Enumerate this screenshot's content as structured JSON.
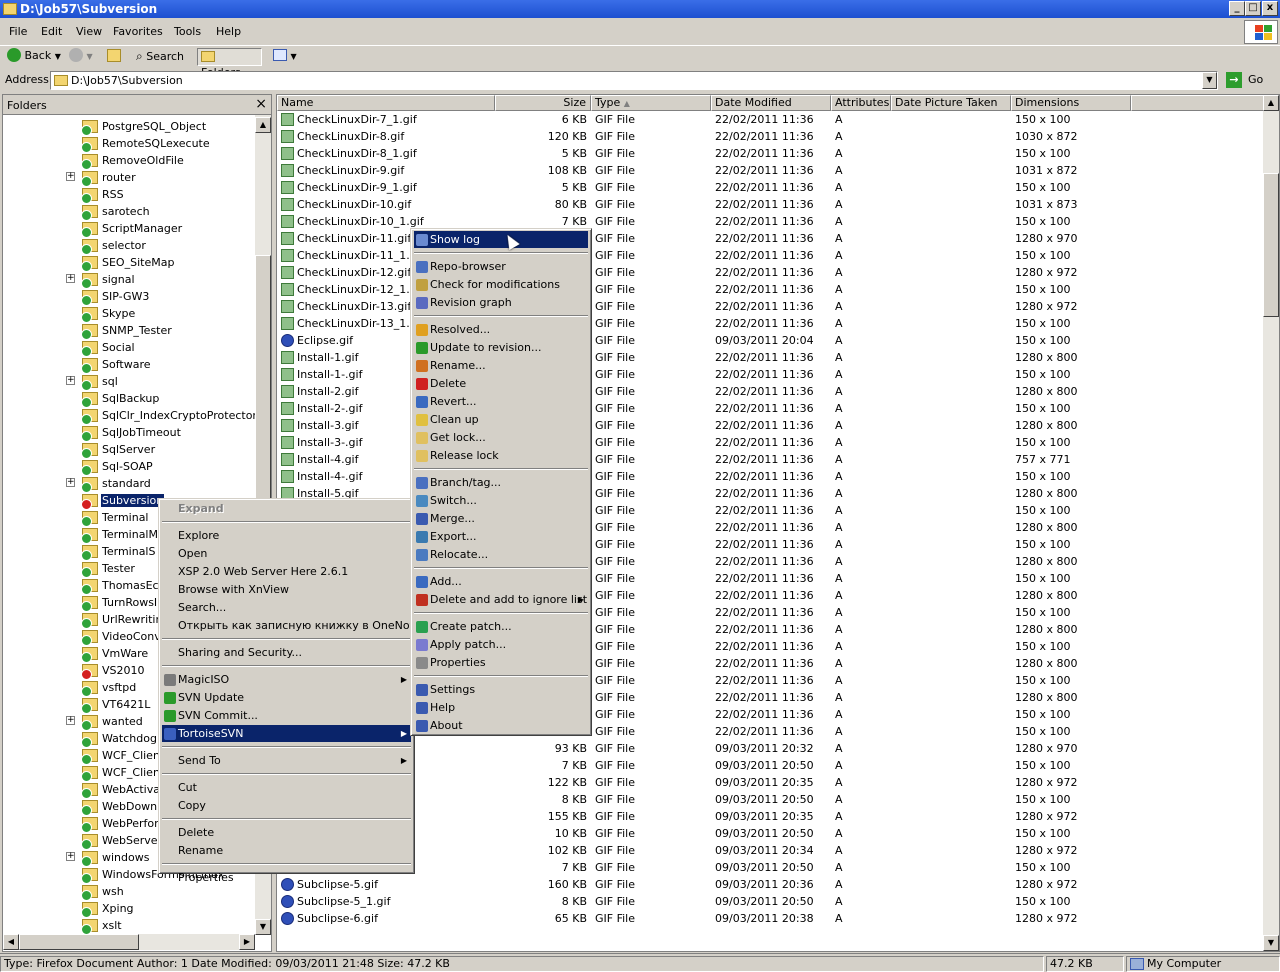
{
  "window": {
    "title": "D:\\Job57\\Subversion",
    "buttons": {
      "min": "_",
      "max": "□",
      "close": "x"
    }
  },
  "menubar": [
    "File",
    "Edit",
    "View",
    "Favorites",
    "Tools",
    "Help"
  ],
  "toolbar": {
    "back": "Back",
    "search": "Search",
    "folders": "Folders"
  },
  "address": {
    "label": "Address",
    "value": "D:\\Job57\\Subversion",
    "go": "Go"
  },
  "folders_pane": {
    "title": "Folders",
    "items": [
      {
        "label": "PostgreSQL_Object",
        "exp": false
      },
      {
        "label": "RemoteSQLexecute",
        "exp": false
      },
      {
        "label": "RemoveOldFile",
        "exp": false
      },
      {
        "label": "router",
        "exp": true
      },
      {
        "label": "RSS",
        "exp": false
      },
      {
        "label": "sarotech",
        "exp": false
      },
      {
        "label": "ScriptManager",
        "exp": false
      },
      {
        "label": "selector",
        "exp": false
      },
      {
        "label": "SEO_SiteMap",
        "exp": false
      },
      {
        "label": "signal",
        "exp": true
      },
      {
        "label": "SIP-GW3",
        "exp": false
      },
      {
        "label": "Skype",
        "exp": false
      },
      {
        "label": "SNMP_Tester",
        "exp": false
      },
      {
        "label": "Social",
        "exp": false
      },
      {
        "label": "Software",
        "exp": false
      },
      {
        "label": "sql",
        "exp": true
      },
      {
        "label": "SqlBackup",
        "exp": false
      },
      {
        "label": "SqlClr_IndexCryptoProtector",
        "exp": false
      },
      {
        "label": "SqlJobTimeout",
        "exp": false
      },
      {
        "label": "SqlServer",
        "exp": false
      },
      {
        "label": "Sql-SOAP",
        "exp": false
      },
      {
        "label": "standard",
        "exp": true
      },
      {
        "label": "Subversion",
        "exp": false,
        "selected": true,
        "warn": true
      },
      {
        "label": "Terminal",
        "exp": false
      },
      {
        "label": "TerminalMo",
        "exp": false
      },
      {
        "label": "TerminalS",
        "exp": false
      },
      {
        "label": "Tester",
        "exp": false
      },
      {
        "label": "ThomasEck",
        "exp": false
      },
      {
        "label": "TurnRowsI",
        "exp": false
      },
      {
        "label": "UrlRewritin",
        "exp": false
      },
      {
        "label": "VideoConve",
        "exp": false
      },
      {
        "label": "VmWare",
        "exp": false
      },
      {
        "label": "VS2010",
        "exp": false,
        "warn": true
      },
      {
        "label": "vsftpd",
        "exp": false
      },
      {
        "label": "VT6421L",
        "exp": false
      },
      {
        "label": "wanted",
        "exp": true
      },
      {
        "label": "Watchdog",
        "exp": false
      },
      {
        "label": "WCF_Client",
        "exp": false
      },
      {
        "label": "WCF_Client",
        "exp": false
      },
      {
        "label": "WebActivat",
        "exp": false
      },
      {
        "label": "WebDownlo",
        "exp": false
      },
      {
        "label": "WebPerfor",
        "exp": false
      },
      {
        "label": "WebServer",
        "exp": false
      },
      {
        "label": "windows",
        "exp": true
      },
      {
        "label": "WindowsFormsInLinux",
        "exp": false
      },
      {
        "label": "wsh",
        "exp": false
      },
      {
        "label": "Xping",
        "exp": false
      },
      {
        "label": "xslt",
        "exp": false
      }
    ]
  },
  "columns": [
    "Name",
    "Size",
    "Type",
    "Date Modified",
    "Attributes",
    "Date Picture Taken",
    "Dimensions"
  ],
  "files": [
    {
      "name": "CheckLinuxDir-7_1.gif",
      "size": "6 KB",
      "type": "GIF File",
      "date": "22/02/2011 11:36",
      "attr": "A",
      "dim": "150 x 100"
    },
    {
      "name": "CheckLinuxDir-8.gif",
      "size": "120 KB",
      "type": "GIF File",
      "date": "22/02/2011 11:36",
      "attr": "A",
      "dim": "1030 x 872"
    },
    {
      "name": "CheckLinuxDir-8_1.gif",
      "size": "5 KB",
      "type": "GIF File",
      "date": "22/02/2011 11:36",
      "attr": "A",
      "dim": "150 x 100"
    },
    {
      "name": "CheckLinuxDir-9.gif",
      "size": "108 KB",
      "type": "GIF File",
      "date": "22/02/2011 11:36",
      "attr": "A",
      "dim": "1031 x 872"
    },
    {
      "name": "CheckLinuxDir-9_1.gif",
      "size": "5 KB",
      "type": "GIF File",
      "date": "22/02/2011 11:36",
      "attr": "A",
      "dim": "150 x 100"
    },
    {
      "name": "CheckLinuxDir-10.gif",
      "size": "80 KB",
      "type": "GIF File",
      "date": "22/02/2011 11:36",
      "attr": "A",
      "dim": "1031 x 873"
    },
    {
      "name": "CheckLinuxDir-10_1.gif",
      "size": "7 KB",
      "type": "GIF File",
      "date": "22/02/2011 11:36",
      "attr": "A",
      "dim": "150 x 100"
    },
    {
      "name": "CheckLinuxDir-11.gif",
      "size": "",
      "type": "GIF File",
      "date": "22/02/2011 11:36",
      "attr": "A",
      "dim": "1280 x 970"
    },
    {
      "name": "CheckLinuxDir-11_1.gif",
      "size": "",
      "type": "GIF File",
      "date": "22/02/2011 11:36",
      "attr": "A",
      "dim": "150 x 100"
    },
    {
      "name": "CheckLinuxDir-12.gif",
      "size": "",
      "type": "GIF File",
      "date": "22/02/2011 11:36",
      "attr": "A",
      "dim": "1280 x 972"
    },
    {
      "name": "CheckLinuxDir-12_1.gif",
      "size": "",
      "type": "GIF File",
      "date": "22/02/2011 11:36",
      "attr": "A",
      "dim": "150 x 100"
    },
    {
      "name": "CheckLinuxDir-13.gif",
      "size": "",
      "type": "GIF File",
      "date": "22/02/2011 11:36",
      "attr": "A",
      "dim": "1280 x 972"
    },
    {
      "name": "CheckLinuxDir-13_1.gif",
      "size": "",
      "type": "GIF File",
      "date": "22/02/2011 11:36",
      "attr": "A",
      "dim": "150 x 100"
    },
    {
      "name": "Eclipse.gif",
      "size": "",
      "type": "GIF File",
      "date": "09/03/2011 20:04",
      "attr": "A",
      "dim": "150 x 100",
      "q": true
    },
    {
      "name": "Install-1.gif",
      "size": "",
      "type": "GIF File",
      "date": "22/02/2011 11:36",
      "attr": "A",
      "dim": "1280 x 800"
    },
    {
      "name": "Install-1-.gif",
      "size": "",
      "type": "GIF File",
      "date": "22/02/2011 11:36",
      "attr": "A",
      "dim": "150 x 100"
    },
    {
      "name": "Install-2.gif",
      "size": "",
      "type": "GIF File",
      "date": "22/02/2011 11:36",
      "attr": "A",
      "dim": "1280 x 800"
    },
    {
      "name": "Install-2-.gif",
      "size": "",
      "type": "GIF File",
      "date": "22/02/2011 11:36",
      "attr": "A",
      "dim": "150 x 100"
    },
    {
      "name": "Install-3.gif",
      "size": "",
      "type": "GIF File",
      "date": "22/02/2011 11:36",
      "attr": "A",
      "dim": "1280 x 800"
    },
    {
      "name": "Install-3-.gif",
      "size": "",
      "type": "GIF File",
      "date": "22/02/2011 11:36",
      "attr": "A",
      "dim": "150 x 100"
    },
    {
      "name": "Install-4.gif",
      "size": "",
      "type": "GIF File",
      "date": "22/02/2011 11:36",
      "attr": "A",
      "dim": "757 x 771"
    },
    {
      "name": "Install-4-.gif",
      "size": "",
      "type": "GIF File",
      "date": "22/02/2011 11:36",
      "attr": "A",
      "dim": "150 x 100"
    },
    {
      "name": "Install-5.gif",
      "size": "",
      "type": "GIF File",
      "date": "22/02/2011 11:36",
      "attr": "A",
      "dim": "1280 x 800"
    },
    {
      "name": "",
      "size": "",
      "type": "GIF File",
      "date": "22/02/2011 11:36",
      "attr": "A",
      "dim": "150 x 100"
    },
    {
      "name": "",
      "size": "",
      "type": "GIF File",
      "date": "22/02/2011 11:36",
      "attr": "A",
      "dim": "1280 x 800"
    },
    {
      "name": "",
      "size": "",
      "type": "GIF File",
      "date": "22/02/2011 11:36",
      "attr": "A",
      "dim": "150 x 100"
    },
    {
      "name": "",
      "size": "",
      "type": "GIF File",
      "date": "22/02/2011 11:36",
      "attr": "A",
      "dim": "1280 x 800"
    },
    {
      "name": "",
      "size": "",
      "type": "GIF File",
      "date": "22/02/2011 11:36",
      "attr": "A",
      "dim": "150 x 100"
    },
    {
      "name": "",
      "size": "",
      "type": "GIF File",
      "date": "22/02/2011 11:36",
      "attr": "A",
      "dim": "1280 x 800"
    },
    {
      "name": "",
      "size": "",
      "type": "GIF File",
      "date": "22/02/2011 11:36",
      "attr": "A",
      "dim": "150 x 100"
    },
    {
      "name": "",
      "size": "",
      "type": "GIF File",
      "date": "22/02/2011 11:36",
      "attr": "A",
      "dim": "1280 x 800"
    },
    {
      "name": "",
      "size": "",
      "type": "GIF File",
      "date": "22/02/2011 11:36",
      "attr": "A",
      "dim": "150 x 100"
    },
    {
      "name": "",
      "size": "",
      "type": "GIF File",
      "date": "22/02/2011 11:36",
      "attr": "A",
      "dim": "1280 x 800"
    },
    {
      "name": "",
      "size": "",
      "type": "GIF File",
      "date": "22/02/2011 11:36",
      "attr": "A",
      "dim": "150 x 100"
    },
    {
      "name": "",
      "size": "",
      "type": "GIF File",
      "date": "22/02/2011 11:36",
      "attr": "A",
      "dim": "1280 x 800"
    },
    {
      "name": "",
      "size": "",
      "type": "GIF File",
      "date": "22/02/2011 11:36",
      "attr": "A",
      "dim": "150 x 100"
    },
    {
      "name": "",
      "size": "6 KB",
      "type": "GIF File",
      "date": "22/02/2011 11:36",
      "attr": "A",
      "dim": "150 x 100"
    },
    {
      "name": "",
      "size": "93 KB",
      "type": "GIF File",
      "date": "09/03/2011 20:32",
      "attr": "A",
      "dim": "1280 x 970"
    },
    {
      "name": "",
      "size": "7 KB",
      "type": "GIF File",
      "date": "09/03/2011 20:50",
      "attr": "A",
      "dim": "150 x 100"
    },
    {
      "name": "",
      "size": "122 KB",
      "type": "GIF File",
      "date": "09/03/2011 20:35",
      "attr": "A",
      "dim": "1280 x 972"
    },
    {
      "name": "",
      "size": "8 KB",
      "type": "GIF File",
      "date": "09/03/2011 20:50",
      "attr": "A",
      "dim": "150 x 100"
    },
    {
      "name": "",
      "size": "155 KB",
      "type": "GIF File",
      "date": "09/03/2011 20:35",
      "attr": "A",
      "dim": "1280 x 972"
    },
    {
      "name": "",
      "size": "10 KB",
      "type": "GIF File",
      "date": "09/03/2011 20:50",
      "attr": "A",
      "dim": "150 x 100"
    },
    {
      "name": "",
      "size": "102 KB",
      "type": "GIF File",
      "date": "09/03/2011 20:34",
      "attr": "A",
      "dim": "1280 x 972"
    },
    {
      "name": "Subclipse-4_1.gif",
      "size": "7 KB",
      "type": "GIF File",
      "date": "09/03/2011 20:50",
      "attr": "A",
      "dim": "150 x 100",
      "q": true
    },
    {
      "name": "Subclipse-5.gif",
      "size": "160 KB",
      "type": "GIF File",
      "date": "09/03/2011 20:36",
      "attr": "A",
      "dim": "1280 x 972",
      "q": true
    },
    {
      "name": "Subclipse-5_1.gif",
      "size": "8 KB",
      "type": "GIF File",
      "date": "09/03/2011 20:50",
      "attr": "A",
      "dim": "150 x 100",
      "q": true
    },
    {
      "name": "Subclipse-6.gif",
      "size": "65 KB",
      "type": "GIF File",
      "date": "09/03/2011 20:38",
      "attr": "A",
      "dim": "1280 x 972",
      "q": true
    }
  ],
  "context_menu": {
    "items": [
      {
        "label": "Expand",
        "type": "disabled"
      },
      {
        "type": "sep"
      },
      {
        "label": "Explore"
      },
      {
        "label": "Open"
      },
      {
        "label": "XSP 2.0 Web Server Here 2.6.1"
      },
      {
        "label": "Browse with XnView"
      },
      {
        "label": "Search..."
      },
      {
        "label": "Открыть как записную книжку в OneNote"
      },
      {
        "type": "sep"
      },
      {
        "label": "Sharing and Security..."
      },
      {
        "type": "sep"
      },
      {
        "label": "MagicISO",
        "submenu": true,
        "icon": "#7a7a7a"
      },
      {
        "label": "SVN Update",
        "icon": "#2a9a2a"
      },
      {
        "label": "SVN Commit...",
        "icon": "#2a9a2a"
      },
      {
        "label": "TortoiseSVN",
        "submenu": true,
        "highlight": true,
        "icon": "#3a5fbf"
      },
      {
        "type": "sep"
      },
      {
        "label": "Send To",
        "submenu": true
      },
      {
        "type": "sep"
      },
      {
        "label": "Cut"
      },
      {
        "label": "Copy"
      },
      {
        "type": "sep"
      },
      {
        "label": "Delete"
      },
      {
        "label": "Rename"
      },
      {
        "type": "sep"
      },
      {
        "label": "Properties"
      }
    ]
  },
  "svn_menu": {
    "items": [
      {
        "label": "Show log",
        "highlight": true,
        "icon": "#6a8ad0"
      },
      {
        "type": "sep"
      },
      {
        "label": "Repo-browser",
        "icon": "#4a70c0"
      },
      {
        "label": "Check for modifications",
        "icon": "#c0a040"
      },
      {
        "label": "Revision graph",
        "icon": "#5a6ac0"
      },
      {
        "type": "sep"
      },
      {
        "label": "Resolved...",
        "icon": "#e0a020"
      },
      {
        "label": "Update to revision...",
        "icon": "#2a9a2a"
      },
      {
        "label": "Rename...",
        "icon": "#d07020"
      },
      {
        "label": "Delete",
        "icon": "#d02020"
      },
      {
        "label": "Revert...",
        "icon": "#3a6ac0"
      },
      {
        "label": "Clean up",
        "icon": "#e0c040"
      },
      {
        "label": "Get lock...",
        "icon": "#e0c060"
      },
      {
        "label": "Release lock",
        "icon": "#e0c060"
      },
      {
        "type": "sep"
      },
      {
        "label": "Branch/tag...",
        "icon": "#4a70c0"
      },
      {
        "label": "Switch...",
        "icon": "#4a8ac0"
      },
      {
        "label": "Merge...",
        "icon": "#3a5ab0"
      },
      {
        "label": "Export...",
        "icon": "#3a7ab0"
      },
      {
        "label": "Relocate...",
        "icon": "#4a7ac0"
      },
      {
        "type": "sep"
      },
      {
        "label": "Add...",
        "icon": "#3a6ac0"
      },
      {
        "label": "Delete and add to ignore list",
        "submenu": true,
        "icon": "#c03020"
      },
      {
        "type": "sep"
      },
      {
        "label": "Create patch...",
        "icon": "#2aa050"
      },
      {
        "label": "Apply patch...",
        "icon": "#7a7ad0"
      },
      {
        "label": "Properties",
        "icon": "#8a8a8a"
      },
      {
        "type": "sep"
      },
      {
        "label": "Settings",
        "icon": "#3a5ab0"
      },
      {
        "label": "Help",
        "icon": "#3a5ab0"
      },
      {
        "label": "About",
        "icon": "#3a5ab0"
      }
    ]
  },
  "statusbar": {
    "info": "Type: Firefox Document Author: 1 Date Modified: 09/03/2011 21:48 Size: 47.2 KB",
    "size": "47.2 KB",
    "zone": "My Computer"
  },
  "colors": {
    "title": "#1c4fd0",
    "selection": "#0a246a",
    "face": "#d4d0c8"
  }
}
